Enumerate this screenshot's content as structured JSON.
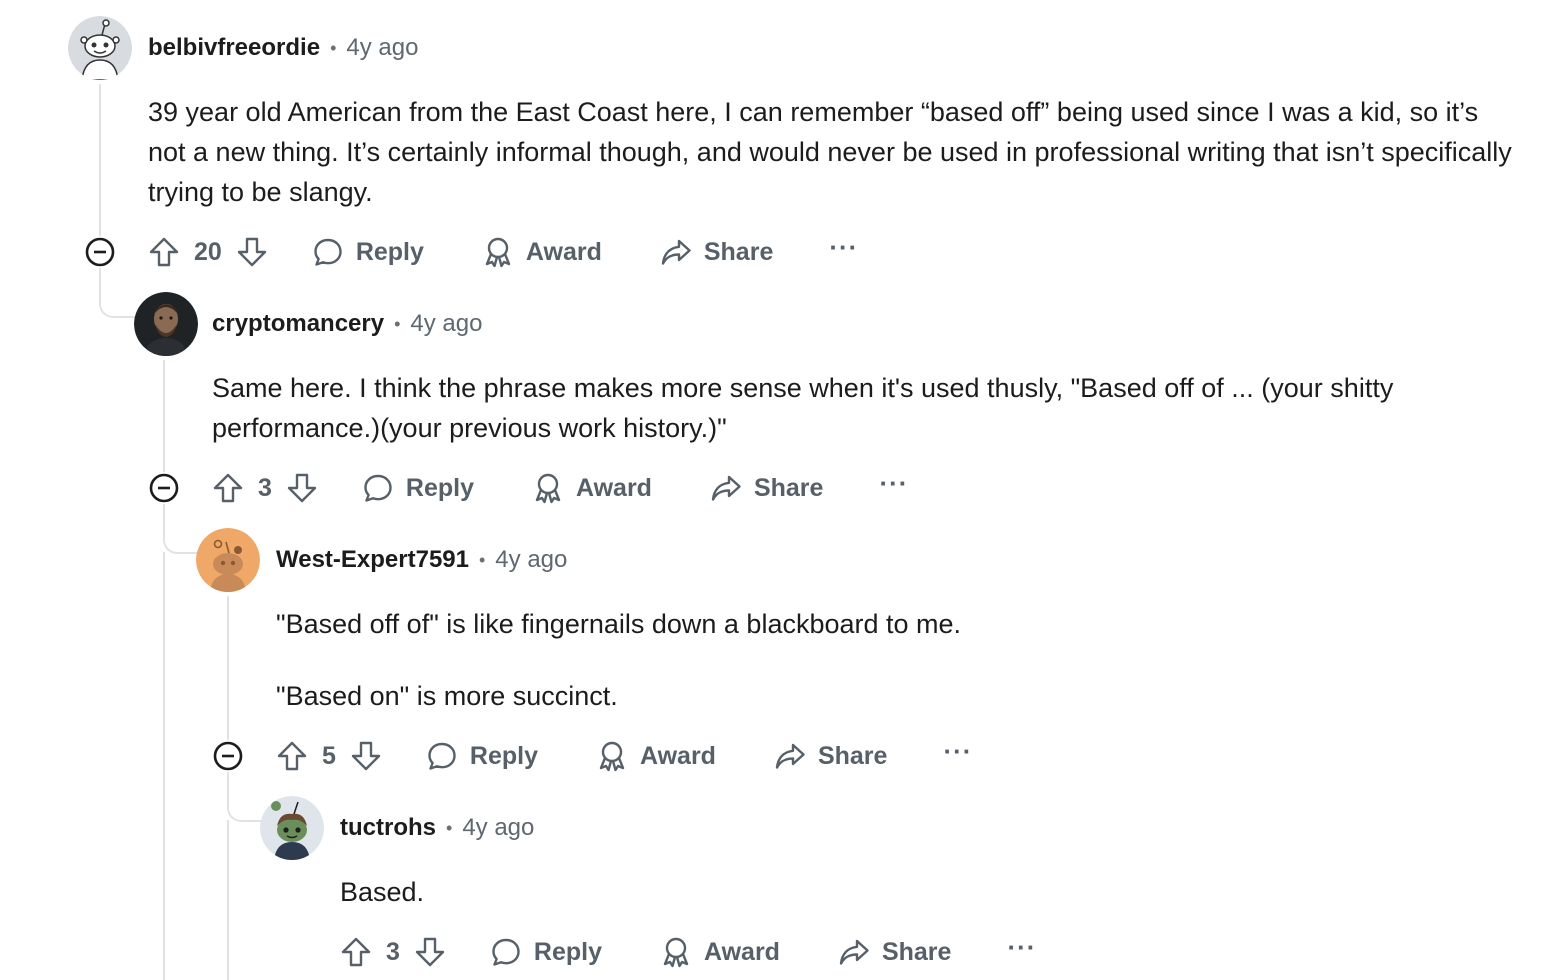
{
  "thread": {
    "comments": [
      {
        "username": "belbivfreeordie",
        "separator": "•",
        "time": "4y ago",
        "paragraphs": [
          "39 year old American from the East Coast here, I can remember “based off” being used since I was a kid, so it’s not a new thing. It’s certainly informal though, and would never be used in professional writing that isn’t specifically trying to be slangy."
        ],
        "score": "20",
        "reply_label": "Reply",
        "award_label": "Award",
        "share_label": "Share",
        "more_label": "···",
        "avatar": "snoo-white-avatar"
      },
      {
        "username": "cryptomancery",
        "separator": "•",
        "time": "4y ago",
        "paragraphs": [
          "Same here. I think the phrase makes more sense when it's used thusly, \"Based off of ... (your shitty performance.)(your previous work history.)\""
        ],
        "score": "3",
        "reply_label": "Reply",
        "award_label": "Award",
        "share_label": "Share",
        "more_label": "···",
        "avatar": "photo-avatar"
      },
      {
        "username": "West-Expert7591",
        "separator": "•",
        "time": "4y ago",
        "paragraphs": [
          "\"Based off of\" is like fingernails down a blackboard to me.",
          "\"Based on\" is more succinct."
        ],
        "score": "5",
        "reply_label": "Reply",
        "award_label": "Award",
        "share_label": "Share",
        "more_label": "···",
        "avatar": "snoo-orange-avatar"
      },
      {
        "username": "tuctrohs",
        "separator": "•",
        "time": "4y ago",
        "paragraphs": [
          "Based."
        ],
        "score": "3",
        "reply_label": "Reply",
        "award_label": "Award",
        "share_label": "Share",
        "more_label": "···",
        "avatar": "snoo-green-avatar"
      }
    ]
  },
  "colors": {
    "text": "#1c1c1c",
    "meta": "#5f6770",
    "action": "#576069",
    "thread_line": "#e2e2e2"
  }
}
